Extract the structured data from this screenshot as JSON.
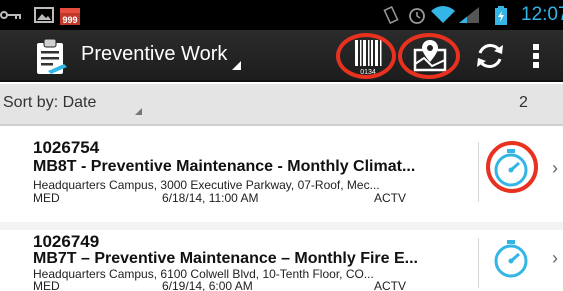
{
  "status_bar": {
    "time": "12:07",
    "icons": [
      "key-icon",
      "image-icon",
      "calendar-icon",
      "vibrate-icon",
      "alarm-icon",
      "wifi-icon",
      "signal-icon",
      "battery-icon"
    ]
  },
  "action_bar": {
    "title": "Preventive Work",
    "actions": [
      "barcode-scan-icon",
      "map-location-icon",
      "refresh-icon",
      "overflow-menu-icon"
    ],
    "barcode_digits": "0134",
    "highlight_color": "#e8311e"
  },
  "sort_bar": {
    "label": "Sort by: Date",
    "count": "2"
  },
  "work_orders": [
    {
      "id": "1026754",
      "title": "MB8T - Preventive Maintenance - Monthly Climat...",
      "location": "Headquarters Campus, 3000 Executive Parkway, 07-Roof, Mec...",
      "priority": "MED",
      "date": "6/18/14, 11:00 AM",
      "status": "ACTV",
      "timer_icon": "stopwatch-icon",
      "highlighted": true
    },
    {
      "id": "1026749",
      "title": "MB7T – Preventive Maintenance – Monthly Fire E...",
      "location": "Headquarters Campus, 6100 Colwell Blvd, 10-Tenth Floor, CO...",
      "priority": "MED",
      "date": "6/19/14, 6:00 AM",
      "status": "ACTV",
      "timer_icon": "stopwatch-icon",
      "highlighted": false
    }
  ],
  "colors": {
    "accent": "#33b5e5",
    "action_bar": "#222222",
    "sort_bar": "#e4e4e4"
  }
}
